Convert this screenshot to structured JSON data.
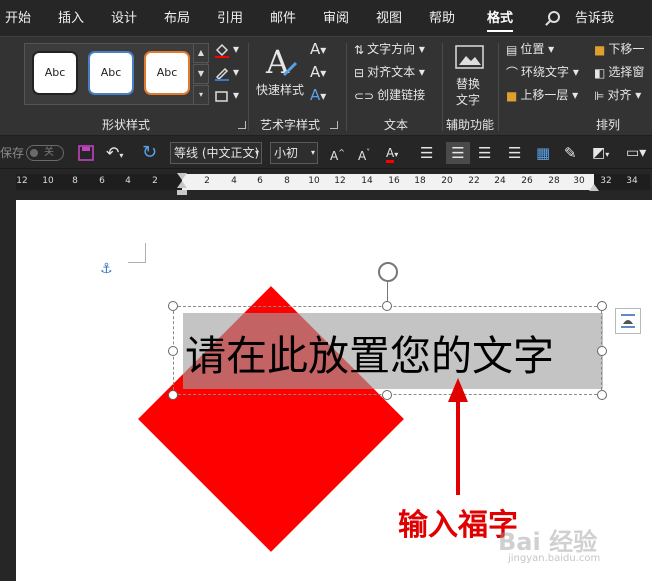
{
  "tabs": {
    "home": "开始",
    "insert": "插入",
    "design": "设计",
    "layout": "布局",
    "references": "引用",
    "mailings": "邮件",
    "review": "审阅",
    "view": "视图",
    "help": "帮助",
    "format": "格式",
    "tell_me": "告诉我"
  },
  "ribbon": {
    "shape_styles": {
      "preset_label": "Abc",
      "group_label": "形状样式"
    },
    "wordart": {
      "quick_styles": "快速样式",
      "group_label": "艺术字样式"
    },
    "text": {
      "direction": "文字方向",
      "align": "对齐文本",
      "link": "创建链接",
      "group_label": "文本"
    },
    "accessibility": {
      "alt_text_line1": "替换",
      "alt_text_line2": "文字",
      "group_label": "辅助功能"
    },
    "arrange": {
      "position": "位置",
      "wrap_text": "环绕文字",
      "bring_forward": "上移一层",
      "send_backward": "下移一",
      "selection_pane": "选择窗",
      "align": "对齐",
      "group_label": "排列"
    }
  },
  "qat": {
    "autosave": "保存",
    "autosave_state": "关",
    "font_name": "等线 (中文正文)",
    "font_size": "小初"
  },
  "ruler": {
    "left_numbers": [
      "12",
      "10",
      "8",
      "6",
      "4",
      "2"
    ],
    "right_numbers": [
      "2",
      "4",
      "6",
      "8",
      "10",
      "12",
      "14",
      "16",
      "18",
      "20",
      "22",
      "24",
      "26",
      "28",
      "30",
      "32",
      "34"
    ]
  },
  "document": {
    "textbox_text": "请在此放置您的文字",
    "annotation": "输入福字",
    "watermark": "Bai 经验",
    "watermark_url": "jingyan.baidu.com"
  },
  "colors": {
    "diamond": "#ff0000",
    "annotation": "#e00000",
    "ribbon_bg": "#333333",
    "tabbar_bg": "#262626"
  }
}
